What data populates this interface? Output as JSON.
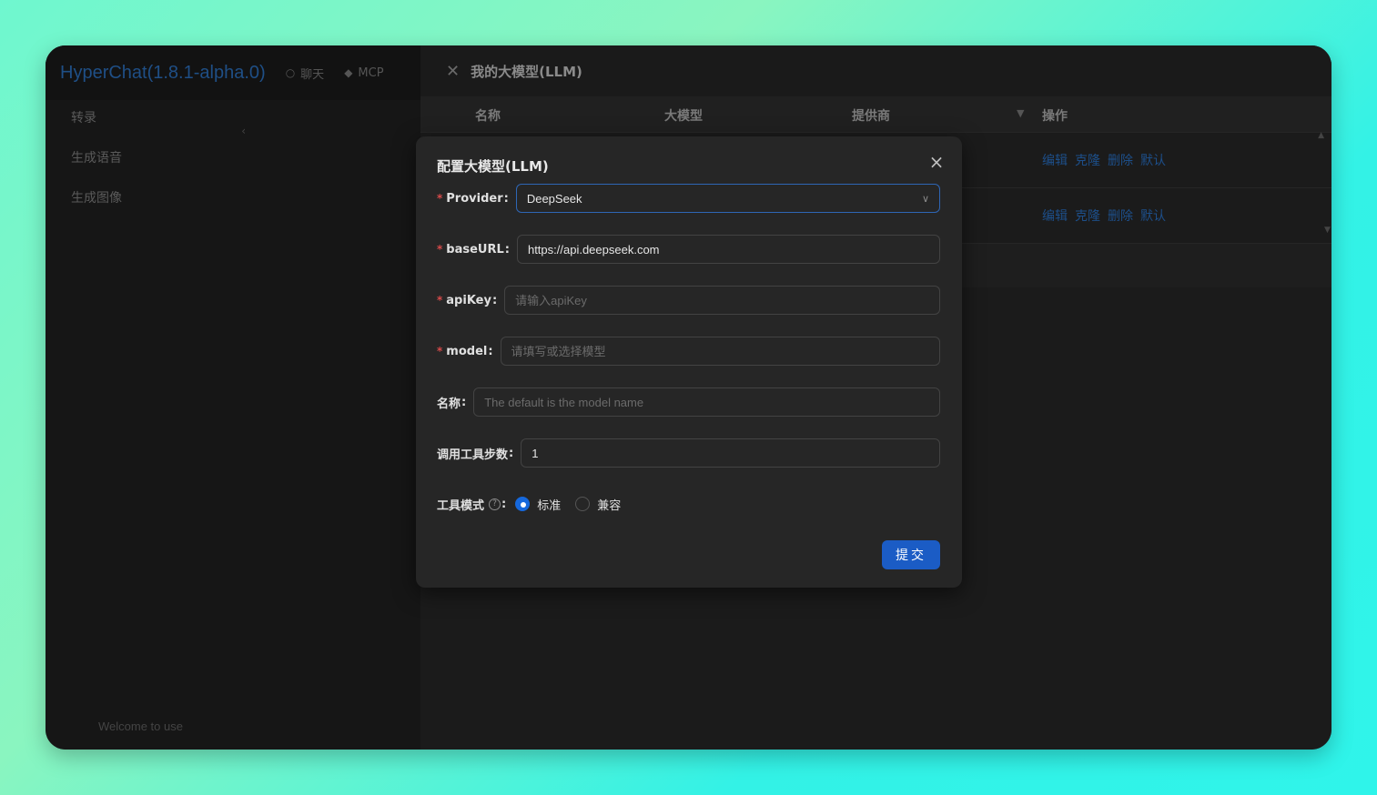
{
  "app": {
    "title": "HyperChat(1.8.1-alpha.0)",
    "nav": [
      {
        "label": "聊天",
        "icon": "chat-icon"
      },
      {
        "label": "MCP",
        "icon": "mcp-icon"
      }
    ],
    "sidebar_items": [
      "转录",
      "生成语音",
      "生成图像"
    ],
    "welcome": "Welcome to use"
  },
  "drawer": {
    "title": "我的大模型(LLM)",
    "columns": [
      "名称",
      "大模型",
      "提供商",
      "操作"
    ],
    "rows": [
      {
        "actions": [
          "编辑",
          "克隆",
          "删除",
          "默认"
        ]
      },
      {
        "actions": [
          "编辑",
          "克隆",
          "删除",
          "默认"
        ]
      }
    ]
  },
  "modal": {
    "title": "配置大模型(LLM)",
    "provider": {
      "label": "Provider",
      "value": "DeepSeek"
    },
    "baseURL": {
      "label": "baseURL",
      "value": "https://api.deepseek.com"
    },
    "apiKey": {
      "label": "apiKey",
      "placeholder": "请输入apiKey"
    },
    "model": {
      "label": "model",
      "placeholder": "请填写或选择模型"
    },
    "name": {
      "label": "名称",
      "placeholder": "The default is the model name"
    },
    "tool_steps": {
      "label": "调用工具步数",
      "value": "1"
    },
    "tool_mode": {
      "label": "工具模式",
      "options": [
        "标准",
        "兼容"
      ],
      "selected": "标准"
    },
    "submit_label": "提交"
  },
  "colors": {
    "accent": "#1b5cc5",
    "required": "#d84a4a",
    "link": "#1d4f8a"
  }
}
